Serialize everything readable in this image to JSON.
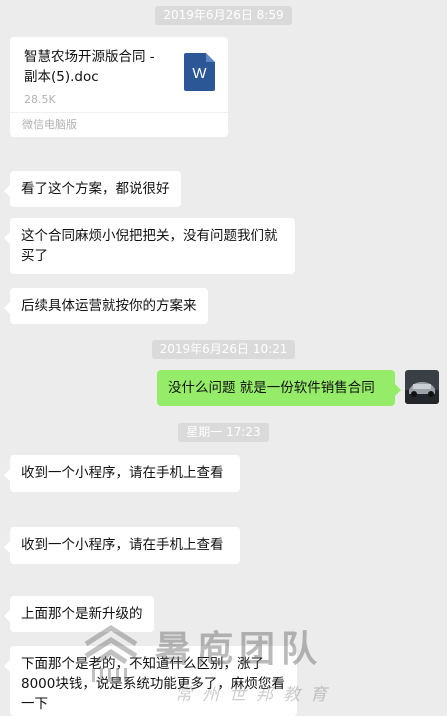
{
  "timestamps": [
    "2019年6月26日 8:59",
    "2019年6月26日 10:21",
    "星期一 17:23"
  ],
  "file_message": {
    "name": "智慧农场开源版合同 - 副本(5).doc",
    "size": "28.5K",
    "source": "微信电脑版",
    "icon_letter": "W",
    "icon_name": "word-doc-icon"
  },
  "messages": [
    {
      "side": "left",
      "text": "看了这个方案，都说很好"
    },
    {
      "side": "left",
      "text": "这个合同麻烦小倪把把关，没有问题我们就买了"
    },
    {
      "side": "left",
      "text": "后续具体运营就按你的方案来"
    },
    {
      "side": "right",
      "text": "没什么问题 就是一份软件销售合同"
    },
    {
      "side": "left",
      "text": "收到一个小程序，请在手机上查看"
    },
    {
      "side": "left",
      "text": "收到一个小程序，请在手机上查看"
    },
    {
      "side": "left",
      "text": "上面那个是新升级的"
    },
    {
      "side": "left",
      "text": "下面那个是老的，不知道什么区别，涨了8000块钱，说是系统功能更多了，麻烦您看一下"
    }
  ],
  "watermark": {
    "main": "暑庖团队",
    "sub": "常州世邦教育"
  },
  "colors": {
    "background": "#ececec",
    "bubble_left": "#ffffff",
    "bubble_right": "#95ec69",
    "doc_icon": "#2b5797"
  }
}
